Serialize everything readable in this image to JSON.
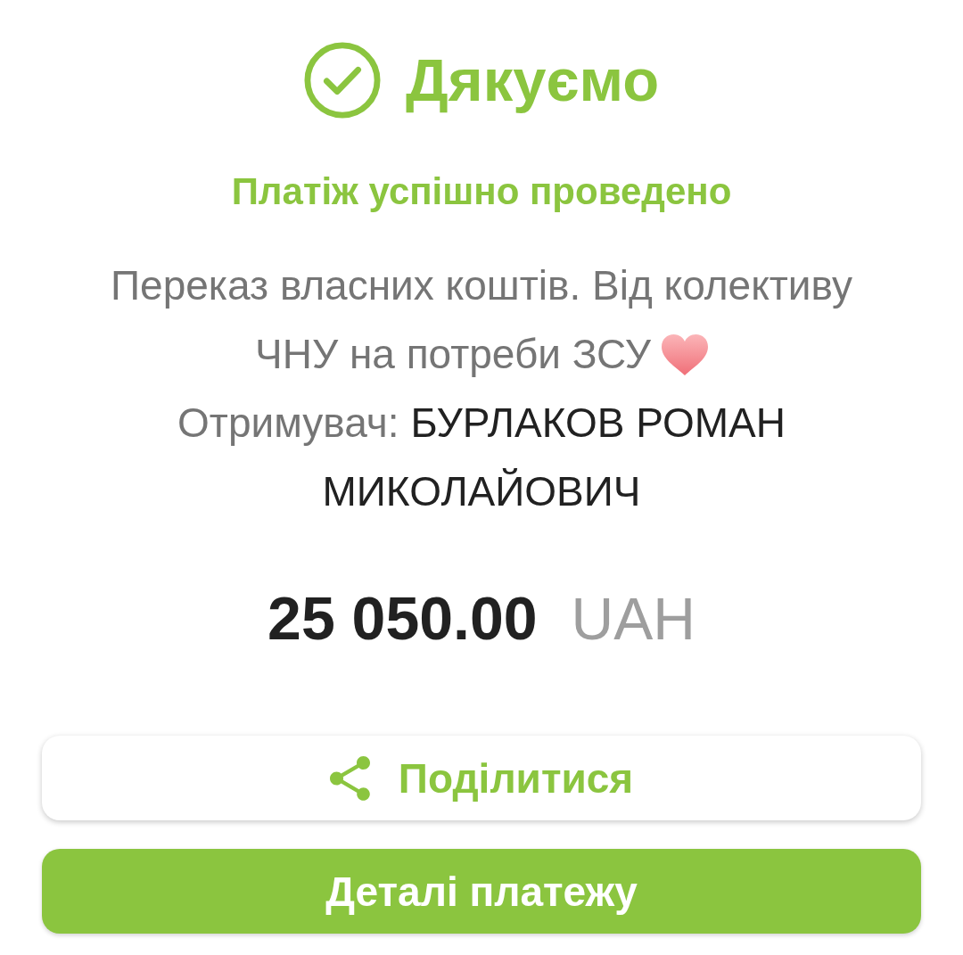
{
  "title": "Дякуємо",
  "subtitle": "Платіж успішно проведено",
  "description_lines": [
    "Переказ власних коштів. Від колективу",
    "ЧНУ на потреби ЗСУ"
  ],
  "recipient": {
    "label": "Отримувач:",
    "name": "БУРЛАКОВ РОМАН МИКОЛАЙОВИЧ"
  },
  "amount": {
    "value": "25 050.00",
    "currency": "UAH"
  },
  "buttons": [
    {
      "kind": "secondary",
      "label": "Поділитися"
    },
    {
      "kind": "primary",
      "label": "Деталі платежу"
    }
  ]
}
